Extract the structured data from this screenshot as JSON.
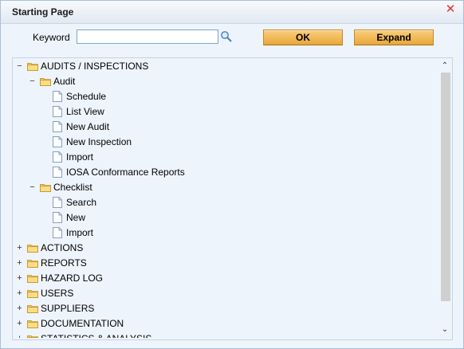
{
  "dialog": {
    "title": "Starting Page",
    "close_icon": "close-x-icon"
  },
  "search": {
    "keyword_label": "Keyword",
    "keyword_value": "",
    "search_icon": "magnifier-icon"
  },
  "buttons": {
    "ok_label": "OK",
    "expand_label": "Expand"
  },
  "colors": {
    "dialog_bg": "#eef4fc",
    "button_gradient_top": "#f9cf7d",
    "button_gradient_bottom": "#e9a63a",
    "close_color": "#d9352b",
    "folder_color": "#f1c14b"
  },
  "tree": {
    "audits": {
      "label": "AUDITS / INSPECTIONS",
      "toggle": "−",
      "audit": {
        "label": "Audit",
        "toggle": "−",
        "items": [
          "Schedule",
          "List View",
          "New Audit",
          "New Inspection",
          "Import",
          "IOSA Conformance Reports"
        ]
      },
      "checklist": {
        "label": "Checklist",
        "toggle": "−",
        "items": [
          "Search",
          "New",
          "Import"
        ]
      }
    },
    "roots": [
      {
        "label": "ACTIONS",
        "toggle": "+"
      },
      {
        "label": "REPORTS",
        "toggle": "+"
      },
      {
        "label": "HAZARD LOG",
        "toggle": "+"
      },
      {
        "label": "USERS",
        "toggle": "+"
      },
      {
        "label": "SUPPLIERS",
        "toggle": "+"
      },
      {
        "label": "DOCUMENTATION",
        "toggle": "+"
      },
      {
        "label": "STATISTICS & ANALYSIS",
        "toggle": "+"
      }
    ]
  },
  "scrollbar": {
    "up_icon": "chevron-up-icon",
    "down_icon": "chevron-down-icon",
    "up_glyph": "⌃",
    "down_glyph": "⌄"
  }
}
